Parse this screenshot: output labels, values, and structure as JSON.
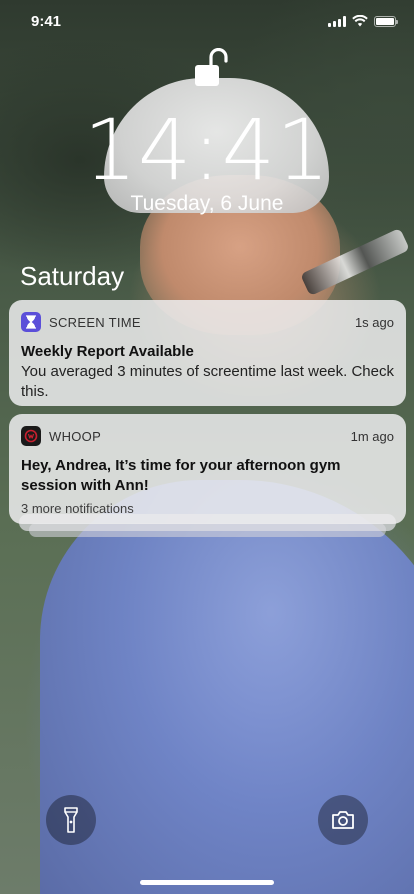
{
  "status_bar": {
    "time": "9:41",
    "icons": [
      "cellular-signal-icon",
      "wifi-icon",
      "battery-icon"
    ],
    "battery_level": 1.0
  },
  "lock_screen": {
    "lock_icon": "unlocked-padlock-icon",
    "clock": "14:41",
    "date": "Tuesday, 6 June",
    "section_header": "Saturday"
  },
  "notifications": [
    {
      "app_icon": "hourglass-icon",
      "app_name": "SCREEN TIME",
      "time_ago": "1s ago",
      "title": "Weekly Report Available",
      "body": "You averaged 3 minutes of screentime last week. Check this.",
      "accent": "#5b4fd9"
    },
    {
      "app_icon": "whoop-icon",
      "app_name": "WHOOP",
      "time_ago": "1m ago",
      "title": "Hey, Andrea, It’s time for your afternoon gym session with Ann!",
      "more": "3 more notifications",
      "accent": "#1a1a1a"
    }
  ],
  "quick_actions": {
    "left_icon": "flashlight-icon",
    "right_icon": "camera-icon"
  },
  "colors": {
    "notification_bg": "#ececee",
    "text_light": "#ffffff"
  }
}
